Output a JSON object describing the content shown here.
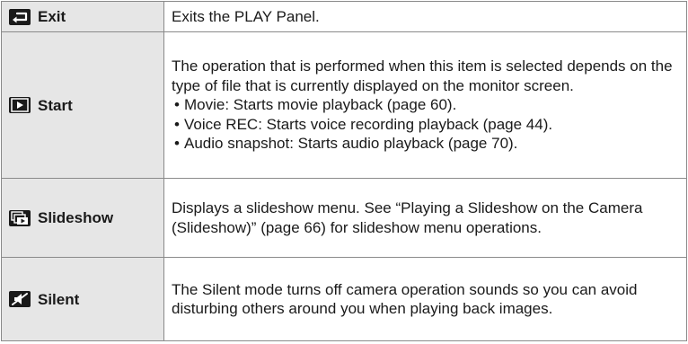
{
  "rows": [
    {
      "name": "Exit",
      "icon": "exit-arrow-icon",
      "description": "Exits the PLAY Panel."
    },
    {
      "name": "Start",
      "icon": "play-icon",
      "description": "The operation that is performed when this item is selected depends on the type of file that is currently displayed on the monitor screen.",
      "bullets": [
        "Movie: Starts movie playback (page 60).",
        "Voice REC: Starts voice recording playback (page 44).",
        "Audio snapshot: Starts audio playback (page 70)."
      ]
    },
    {
      "name": "Slideshow",
      "icon": "slideshow-icon",
      "description": "Displays a slideshow menu. See “Playing a Slideshow on the Camera (Slideshow)” (page 66) for slideshow menu operations."
    },
    {
      "name": "Silent",
      "icon": "silent-icon",
      "description": "The Silent mode turns off camera operation sounds so you can avoid disturbing others around you when playing back images."
    }
  ]
}
